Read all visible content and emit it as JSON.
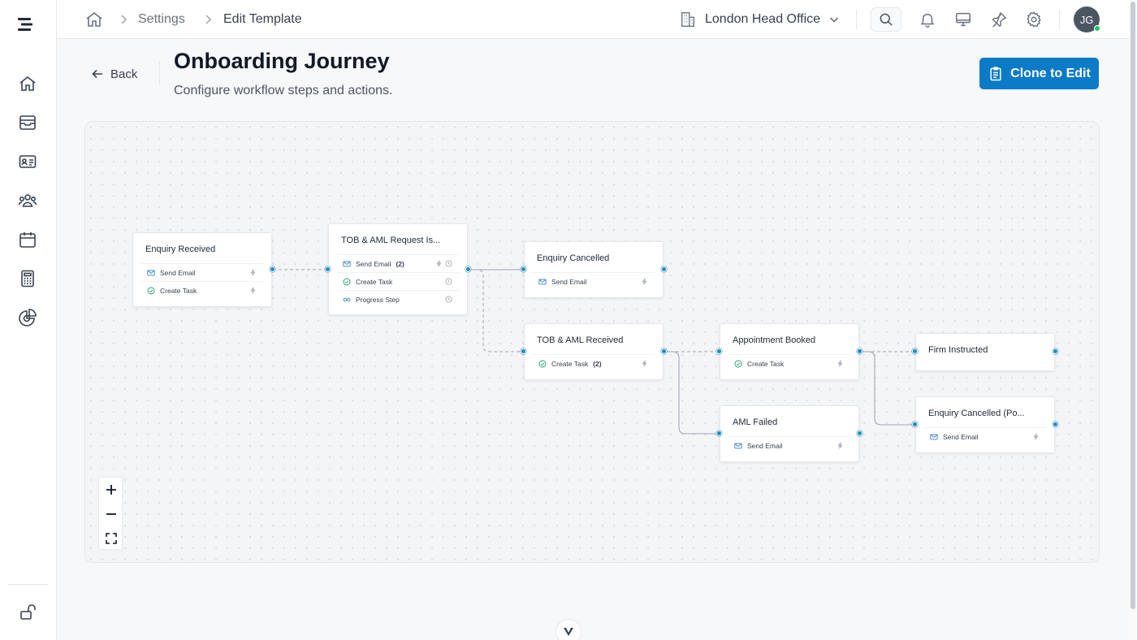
{
  "breadcrumb": {
    "settings": "Settings",
    "current": "Edit Template"
  },
  "office": {
    "name": "London Head Office"
  },
  "user": {
    "initials": "JG"
  },
  "header": {
    "back": "Back",
    "title": "Onboarding Journey",
    "subtitle": "Configure workflow steps and actions.",
    "clone_button": "Clone to Edit"
  },
  "colors": {
    "accent": "#0b7bc8",
    "handle": "#1f8ac0",
    "task_green": "#22a06b",
    "online": "#22c55e"
  },
  "workflow": {
    "nodes": [
      {
        "title": "Enquiry Received",
        "actions": [
          {
            "icon": "mail-icon",
            "label": "Send Email"
          },
          {
            "icon": "check-circle-icon",
            "label": "Create Task"
          }
        ]
      },
      {
        "title": "TOB & AML Request Is...",
        "actions": [
          {
            "icon": "mail-icon",
            "label": "Send Email",
            "count": "(2)"
          },
          {
            "icon": "check-circle-icon",
            "label": "Create Task"
          },
          {
            "icon": "progress-step-icon",
            "label": "Progress Step"
          }
        ]
      },
      {
        "title": "Enquiry Cancelled",
        "actions": [
          {
            "icon": "mail-icon",
            "label": "Send Email"
          }
        ]
      },
      {
        "title": "TOB & AML Received",
        "actions": [
          {
            "icon": "check-circle-icon",
            "label": "Create Task",
            "count": "(2)"
          }
        ]
      },
      {
        "title": "Appointment Booked",
        "actions": [
          {
            "icon": "check-circle-icon",
            "label": "Create Task"
          }
        ]
      },
      {
        "title": "Firm Instructed",
        "actions": []
      },
      {
        "title": "AML Failed",
        "actions": [
          {
            "icon": "mail-icon",
            "label": "Send Email"
          }
        ]
      },
      {
        "title": "Enquiry Cancelled (Po...",
        "actions": [
          {
            "icon": "mail-icon",
            "label": "Send Email"
          }
        ]
      }
    ]
  }
}
